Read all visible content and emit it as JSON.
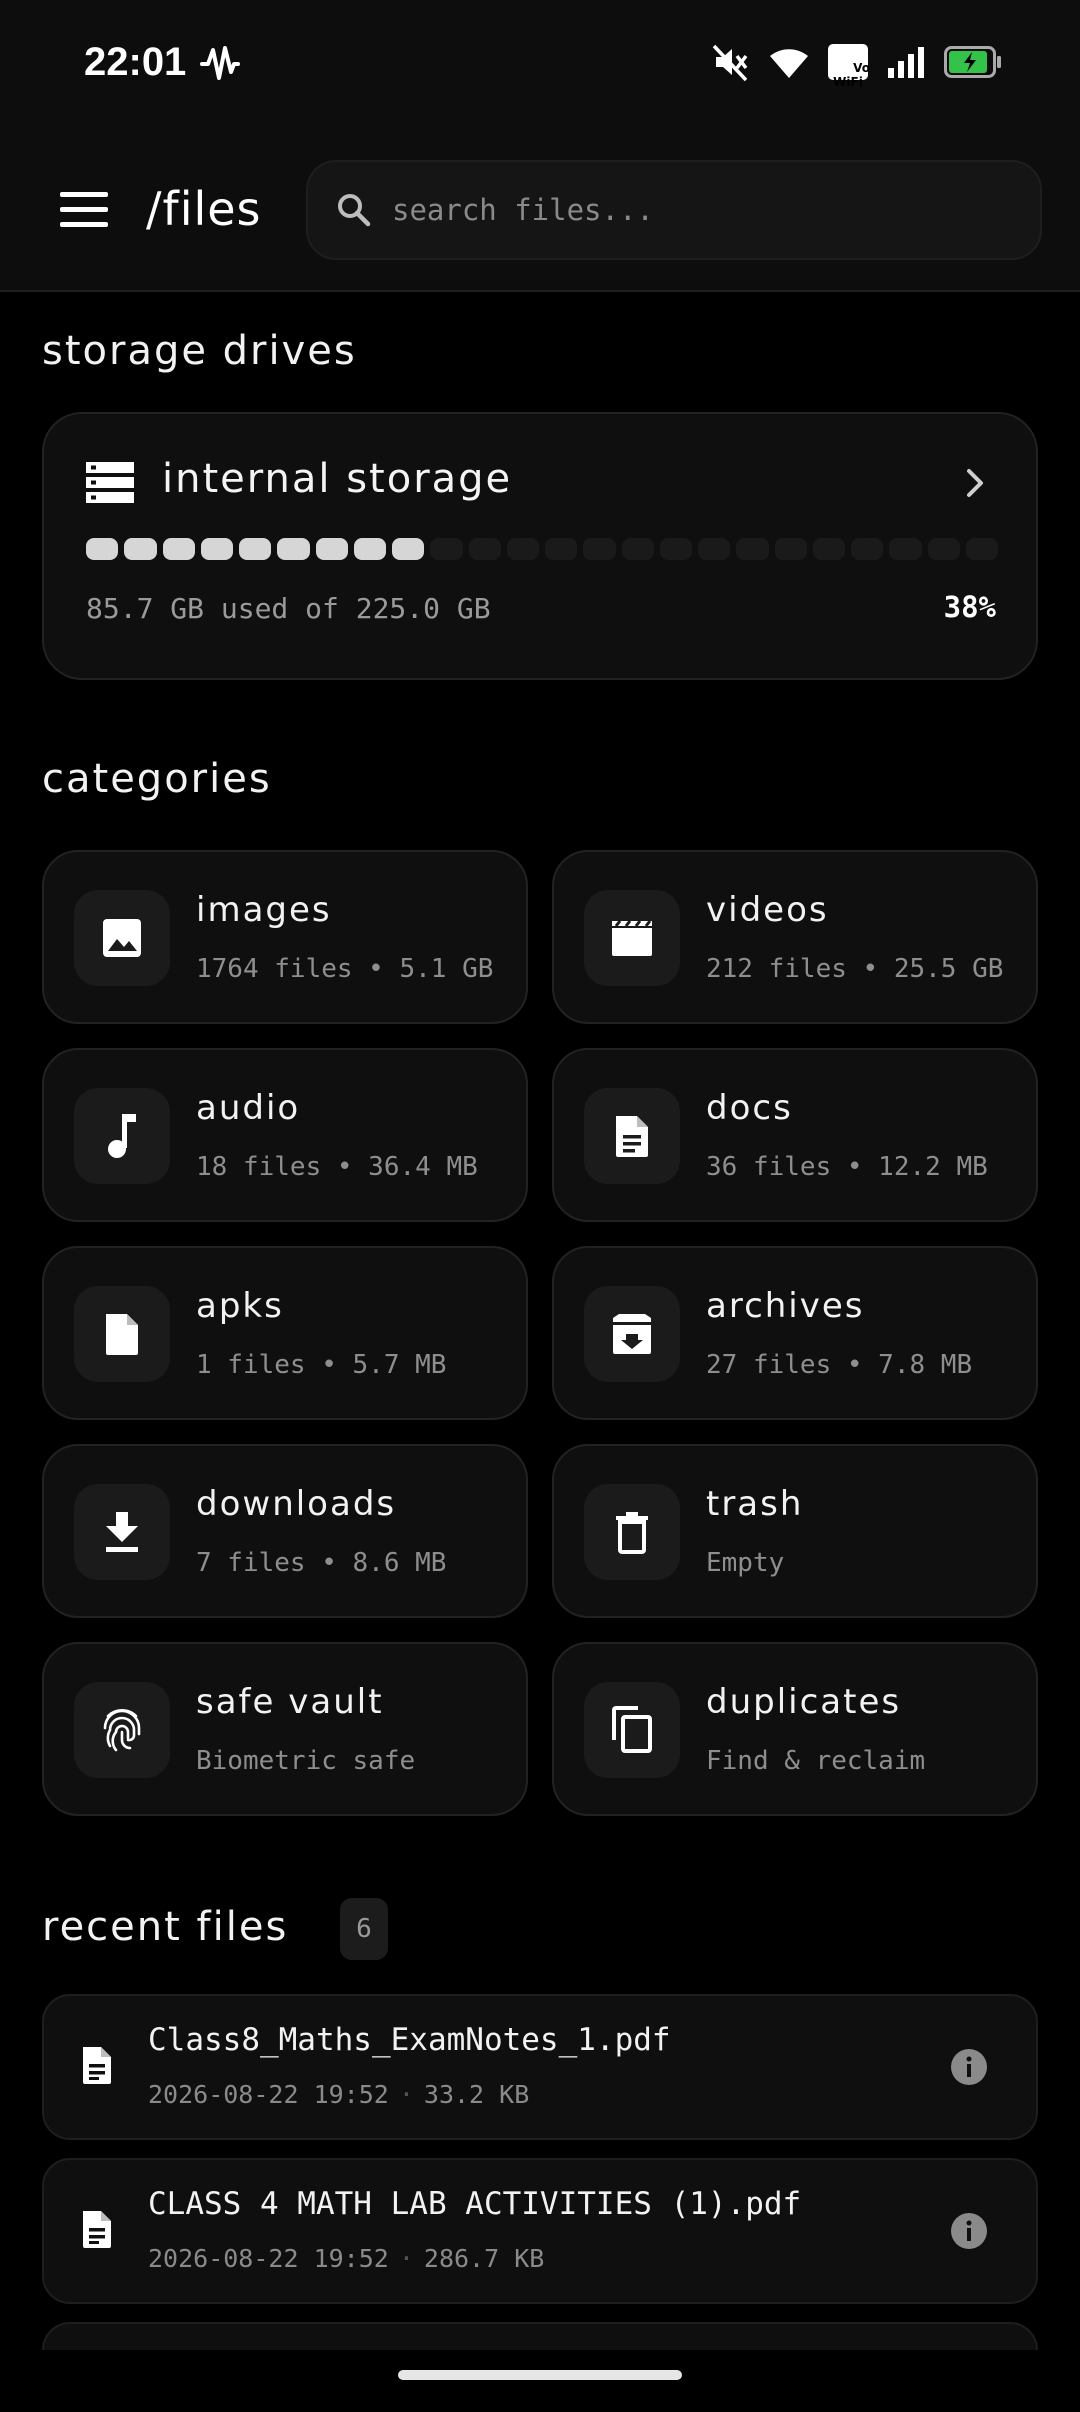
{
  "status_bar": {
    "time": "22:01",
    "vowifi_label": "Vo\nWiFi"
  },
  "app_bar": {
    "title": "/files",
    "search_placeholder": "search files..."
  },
  "storage": {
    "section_title": "storage drives",
    "drive_name": "internal storage",
    "used_text": "85.7 GB used of 225.0 GB",
    "percent_text": "38%",
    "used_fraction": 0.38
  },
  "categories": {
    "section_title": "categories",
    "items": [
      {
        "name": "images",
        "meta": "1764 files • 5.1 GB",
        "icon": "image-icon"
      },
      {
        "name": "videos",
        "meta": "212 files • 25.5 GB",
        "icon": "video-icon"
      },
      {
        "name": "audio",
        "meta": "18 files • 36.4 MB",
        "icon": "music-note-icon"
      },
      {
        "name": "docs",
        "meta": "36 files • 12.2 MB",
        "icon": "document-icon"
      },
      {
        "name": "apks",
        "meta": "1 files • 5.7 MB",
        "icon": "file-icon"
      },
      {
        "name": "archives",
        "meta": "27 files • 7.8 MB",
        "icon": "archive-icon"
      },
      {
        "name": "downloads",
        "meta": "7 files • 8.6 MB",
        "icon": "download-icon"
      },
      {
        "name": "trash",
        "meta": "Empty",
        "icon": "trash-icon"
      },
      {
        "name": "safe vault",
        "meta": "Biometric safe",
        "icon": "fingerprint-icon"
      },
      {
        "name": "duplicates",
        "meta": "Find & reclaim",
        "icon": "copy-icon"
      }
    ]
  },
  "recent": {
    "section_title": "recent files",
    "count": "6",
    "items": [
      {
        "name": "Class8_Maths_ExamNotes_1.pdf",
        "date": "2026-08-22 19:52",
        "size": "33.2 KB"
      },
      {
        "name": "CLASS 4 MATH LAB ACTIVITIES (1).pdf",
        "date": "2026-08-22 19:52",
        "size": "286.7 KB"
      }
    ]
  },
  "colors": {
    "background": "#000000",
    "surface": "#0f0f0f",
    "segment_on": "#d6d6d6",
    "segment_off": "#1a1a1a",
    "battery_green": "#35c24a"
  }
}
